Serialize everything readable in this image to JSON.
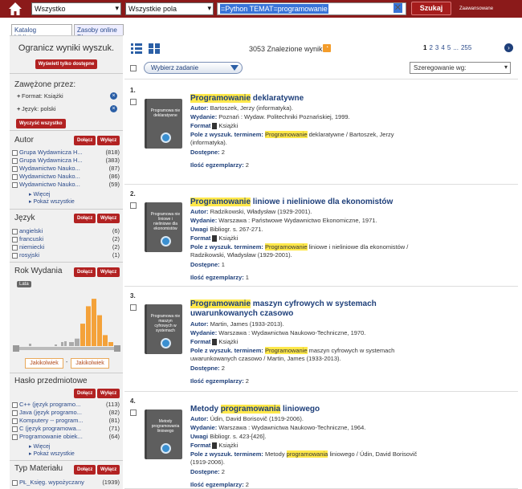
{
  "header": {
    "scope": "Wszystko",
    "field": "Wszystkie pola",
    "query": "=Python TEMAT=programowanie",
    "search_label": "Szukaj",
    "advanced_label": "Zaawansowane"
  },
  "tabs": [
    "Katalog biblioteczny",
    "Zasoby online PŁ"
  ],
  "sidebar": {
    "title": "Ogranicz wyniki wyszuk.",
    "available_only": "Wyświetl tylko dostępne",
    "narrowed_title": "Zawężone przez:",
    "narrowed": [
      "Format: Książki",
      "Język: polski"
    ],
    "clear_all": "Wyczyść wszystko",
    "include": "Dołącz",
    "exclude": "Wyłącz",
    "author": {
      "title": "Autor",
      "items": [
        {
          "label": "Grupa Wydawnicza H...",
          "count": "(818)"
        },
        {
          "label": "Grupa Wydawnicza H...",
          "count": "(383)"
        },
        {
          "label": "Wydawnictwo Nauko...",
          "count": "(87)"
        },
        {
          "label": "Wydawnictwo Nauko...",
          "count": "(86)"
        },
        {
          "label": "Wydawnictwo Nauko...",
          "count": "(59)"
        }
      ]
    },
    "more": "Więcej",
    "show_all": "Pokaż wszystkie",
    "language": {
      "title": "Język",
      "items": [
        {
          "label": "angielski",
          "count": "(6)"
        },
        {
          "label": "francuski",
          "count": "(2)"
        },
        {
          "label": "niemiecki",
          "count": "(2)"
        },
        {
          "label": "rosyjski",
          "count": "(1)"
        }
      ]
    },
    "year": {
      "title": "Rok Wydania",
      "tag": "Lata",
      "from": "Jakikolwiek",
      "sep": "-",
      "to": "Jakikolwiek",
      "histogram": [
        0.08,
        0.15,
        0.45,
        0.8,
        0.95,
        0.62,
        0.22,
        0.08
      ]
    },
    "subject": {
      "title": "Hasło przedmiotowe",
      "items": [
        {
          "label": "C++ (język programo...",
          "count": "(113)"
        },
        {
          "label": "Java (język programo...",
          "count": "(82)"
        },
        {
          "label": "Komputery -- program...",
          "count": "(81)"
        },
        {
          "label": "C (język programowa...",
          "count": "(71)"
        },
        {
          "label": "Programowanie obiek...",
          "count": "(64)"
        }
      ]
    },
    "material": {
      "title": "Typ Materiału",
      "items": [
        {
          "label": "PŁ_Księg. wypożyczany",
          "count": "(1939)"
        }
      ]
    }
  },
  "results_header": {
    "count": "3053 Znalezione wyniki",
    "pages": [
      "1",
      "2",
      "3",
      "4",
      "5",
      "...",
      "255"
    ],
    "select_task": "Wybierz zadanie",
    "sort": "Szeregowanie wg:"
  },
  "labels": {
    "author": "Autor:",
    "edition": "Wydanie:",
    "notes": "Uwagi",
    "format": "Format",
    "format_val": "Książki",
    "subject_field": "Pole z wyszuk. terminem:",
    "available": "Dostępne:",
    "copies": "Ilość egzemplarzy:"
  },
  "results": [
    {
      "num": "1.",
      "cover": "Programowa nie deklaratywne",
      "title_hl": "Programowanie",
      "title_rest": " deklaratywne",
      "author": "Bartoszek, Jerzy (informatyka).",
      "edition": "Poznań : Wydaw. Politechniki Poznańskiej, 1999.",
      "subject_hl": "Programowanie",
      "subject_rest": " deklaratywne / Bartoszek, Jerzy (informatyka).",
      "available": "2",
      "copies": "2"
    },
    {
      "num": "2.",
      "cover": "Programowa nie liniowe i nieliniowe dla ekonomistów",
      "title_hl": "Programowanie",
      "title_rest": " liniowe i nieliniowe dla ekonomistów",
      "author": "Radzikowski, Władysław (1929-2001).",
      "edition": "Warszawa : Państwowe Wydawnictwo Ekonomiczne, 1971.",
      "notes": "Bibliogr. s. 267-271.",
      "subject_hl": "Programowanie",
      "subject_rest": " liniowe i nieliniowe dla ekonomistów / Radzikowski, Władysław (1929-2001).",
      "available": "1",
      "copies": "1"
    },
    {
      "num": "3.",
      "cover": "Programowa nie maszyn cyfrowych w systemach",
      "title_hl": "Programowanie",
      "title_rest": " maszyn cyfrowych w systemach uwarunkowanych czasowo",
      "author": "Martin, James (1933-2013).",
      "edition": "Warszawa : Wydawnictwa Naukowo-Techniczne, 1970.",
      "subject_hl": "Programowanie",
      "subject_rest": " maszyn cyfrowych w systemach uwarunkowanych czasowo / Martin, James (1933-2013).",
      "available": "2",
      "copies": "2"
    },
    {
      "num": "4.",
      "cover": "Metody programowania liniowego",
      "title_pre": "Metody ",
      "title_hl": "programowania",
      "title_rest": " liniowego",
      "author": "Údin, David Borisovič (1919-2006).",
      "edition": "Warszawa : Wydawnictwa Naukowo-Techniczne, 1964.",
      "notes": "Bibliogr. s. 423-[426].",
      "subject_pre": "Metody ",
      "subject_hl": "programowania",
      "subject_rest": " liniowego / Údin, David Borisovič (1919-2006).",
      "available": "2",
      "copies": "2"
    }
  ]
}
